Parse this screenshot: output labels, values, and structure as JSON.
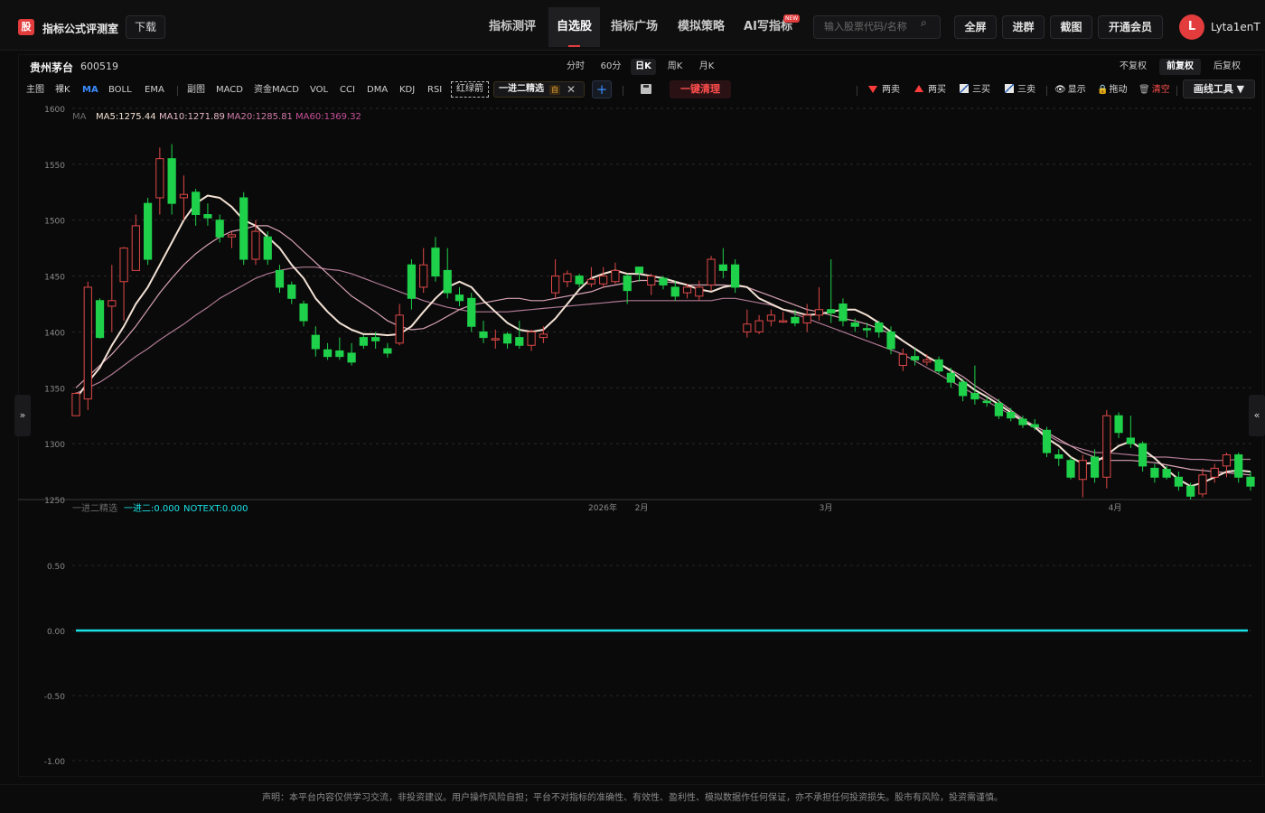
{
  "header": {
    "logo_char": "股",
    "app_title": "指标公式评测室",
    "download": "下载",
    "nav": [
      "指标测评",
      "自选股",
      "指标广场",
      "模拟策略",
      "AI写指标"
    ],
    "nav_active": "自选股",
    "new_badge": "NEW",
    "search_placeholder": "输入股票代码/名称",
    "buttons": [
      "全屏",
      "进群",
      "截图",
      "开通会员"
    ],
    "avatar_letter": "L",
    "username": "Lyta1enT"
  },
  "stock": {
    "name": "贵州茅台",
    "code": "600519"
  },
  "periods": [
    "分时",
    "60分",
    "日K",
    "周K",
    "月K"
  ],
  "period_active": "日K",
  "adjust": [
    "不复权",
    "前复权",
    "后复权"
  ],
  "adjust_active": "前复权",
  "toolbar": {
    "main_indicators": [
      "主图",
      "裸K",
      "MA",
      "BOLL",
      "EMA"
    ],
    "main_active": "MA",
    "sub_indicators": [
      "副图",
      "MACD",
      "资金MACD",
      "VOL",
      "CCI",
      "DMA",
      "KDJ",
      "RSI"
    ],
    "redgreen": "红绿箭",
    "selected_formula": "一进二精选",
    "self_tag": "自",
    "clear_label": "一键清理",
    "signals": [
      "两卖",
      "两买",
      "三买",
      "三卖",
      "显示",
      "拖动",
      "清空"
    ],
    "draw_tools": "画线工具 ▼"
  },
  "ma_legend": {
    "label": "MA",
    "ma5": "MA5:1275.44",
    "ma10": "MA10:1271.89",
    "ma20": "MA20:1285.81",
    "ma60": "MA60:1369.32"
  },
  "sub_legend": {
    "name": "一进二精选",
    "v1": "一进二:0.000",
    "v2": "NOTEXT:0.000"
  },
  "colors": {
    "up": "#e04848",
    "down": "#1fd14a",
    "ma5": "#f3e1d4",
    "ma10": "#d9a3b5",
    "ma20": "#b07a94",
    "ma60": "#9a5a84",
    "sub_line": "#19e3e6",
    "accent": "#e23c3c"
  },
  "chart_data": {
    "type": "candlestick",
    "y_main": {
      "min": 1250,
      "max": 1600,
      "ticks": [
        1600,
        1550,
        1500,
        1450,
        1400,
        1350,
        1300,
        1250
      ]
    },
    "y_sub": {
      "min": -1.0,
      "max": 1.0,
      "ticks": [
        0.5,
        0.0,
        -0.5,
        -1.0
      ]
    },
    "x_labels": [
      "2026年",
      "2月",
      "3月",
      "4月"
    ],
    "candles": [
      [
        1325,
        1345,
        1325,
        1346,
        1325
      ],
      [
        1340,
        1440,
        1335,
        1445,
        1330
      ],
      [
        1428,
        1395,
        1395,
        1430,
        1394
      ],
      [
        1423,
        1428,
        1425,
        1460,
        1400
      ],
      [
        1445,
        1475,
        1440,
        1476,
        1410
      ],
      [
        1455,
        1495,
        1460,
        1505,
        1455
      ],
      [
        1515,
        1465,
        1465,
        1520,
        1460
      ],
      [
        1520,
        1555,
        1515,
        1565,
        1505
      ],
      [
        1555,
        1515,
        1515,
        1568,
        1505
      ],
      [
        1520,
        1523,
        1508,
        1540,
        1500
      ],
      [
        1525,
        1505,
        1505,
        1528,
        1495
      ],
      [
        1505,
        1502,
        1502,
        1515,
        1495
      ],
      [
        1500,
        1485,
        1485,
        1505,
        1480
      ],
      [
        1485,
        1487,
        1485,
        1490,
        1475
      ],
      [
        1520,
        1465,
        1465,
        1525,
        1460
      ],
      [
        1465,
        1490,
        1465,
        1500,
        1460
      ],
      [
        1485,
        1465,
        1465,
        1490,
        1460
      ],
      [
        1455,
        1440,
        1440,
        1460,
        1435
      ],
      [
        1442,
        1430,
        1430,
        1445,
        1425
      ],
      [
        1425,
        1410,
        1410,
        1428,
        1405
      ],
      [
        1397,
        1385,
        1385,
        1405,
        1378
      ],
      [
        1384,
        1378,
        1378,
        1390,
        1375
      ],
      [
        1383,
        1378,
        1380,
        1395,
        1375
      ],
      [
        1381,
        1373,
        1375,
        1390,
        1370
      ],
      [
        1395,
        1388,
        1388,
        1397,
        1385
      ],
      [
        1395,
        1392,
        1392,
        1400,
        1385
      ],
      [
        1385,
        1381,
        1382,
        1390,
        1377
      ],
      [
        1390,
        1415,
        1390,
        1425,
        1388
      ],
      [
        1460,
        1430,
        1430,
        1465,
        1420
      ],
      [
        1440,
        1460,
        1440,
        1475,
        1435
      ],
      [
        1475,
        1450,
        1450,
        1485,
        1445
      ],
      [
        1455,
        1435,
        1435,
        1475,
        1430
      ],
      [
        1433,
        1428,
        1428,
        1440,
        1423
      ],
      [
        1430,
        1405,
        1405,
        1435,
        1400
      ],
      [
        1400,
        1395,
        1395,
        1410,
        1390
      ],
      [
        1394,
        1394,
        1394,
        1402,
        1385
      ],
      [
        1398,
        1390,
        1390,
        1400,
        1385
      ],
      [
        1395,
        1388,
        1388,
        1410,
        1385
      ],
      [
        1388,
        1400,
        1388,
        1402,
        1383
      ],
      [
        1395,
        1398,
        1395,
        1405,
        1390
      ],
      [
        1435,
        1450,
        1432,
        1465,
        1430
      ],
      [
        1445,
        1452,
        1445,
        1455,
        1440
      ],
      [
        1450,
        1443,
        1443,
        1452,
        1440
      ],
      [
        1443,
        1447,
        1443,
        1458,
        1440
      ],
      [
        1443,
        1450,
        1443,
        1458,
        1440
      ],
      [
        1445,
        1455,
        1445,
        1462,
        1443
      ],
      [
        1450,
        1437,
        1437,
        1452,
        1425
      ],
      [
        1458,
        1453,
        1453,
        1458,
        1445
      ],
      [
        1442,
        1450,
        1442,
        1452,
        1433
      ],
      [
        1448,
        1442,
        1442,
        1450,
        1438
      ],
      [
        1440,
        1432,
        1432,
        1446,
        1428
      ],
      [
        1435,
        1440,
        1435,
        1443,
        1430
      ],
      [
        1432,
        1440,
        1432,
        1446,
        1428
      ],
      [
        1442,
        1465,
        1440,
        1468,
        1437
      ],
      [
        1460,
        1455,
        1455,
        1475,
        1448
      ],
      [
        1460,
        1440,
        1440,
        1465,
        1435
      ],
      [
        1400,
        1407,
        1400,
        1420,
        1395
      ],
      [
        1400,
        1410,
        1400,
        1415,
        1398
      ],
      [
        1410,
        1415,
        1410,
        1420,
        1405
      ],
      [
        1410,
        1410,
        1410,
        1418,
        1408
      ],
      [
        1413,
        1408,
        1408,
        1420,
        1405
      ],
      [
        1408,
        1415,
        1408,
        1425,
        1400
      ],
      [
        1415,
        1420,
        1415,
        1440,
        1410
      ],
      [
        1420,
        1417,
        1420,
        1465,
        1408
      ],
      [
        1425,
        1410,
        1410,
        1430,
        1405
      ],
      [
        1408,
        1405,
        1405,
        1412,
        1400
      ],
      [
        1403,
        1402,
        1403,
        1408,
        1395
      ],
      [
        1408,
        1400,
        1400,
        1410,
        1395
      ],
      [
        1400,
        1385,
        1385,
        1405,
        1380
      ],
      [
        1370,
        1380,
        1370,
        1385,
        1365
      ],
      [
        1378,
        1375,
        1375,
        1385,
        1370
      ],
      [
        1373,
        1375,
        1373,
        1380,
        1370
      ],
      [
        1375,
        1365,
        1365,
        1378,
        1362
      ],
      [
        1363,
        1355,
        1355,
        1368,
        1350
      ],
      [
        1355,
        1343,
        1343,
        1358,
        1338
      ],
      [
        1345,
        1340,
        1340,
        1370,
        1335
      ],
      [
        1338,
        1337,
        1337,
        1342,
        1333
      ],
      [
        1336,
        1325,
        1325,
        1340,
        1322
      ],
      [
        1328,
        1323,
        1323,
        1332,
        1320
      ],
      [
        1322,
        1317,
        1317,
        1325,
        1314
      ],
      [
        1317,
        1315,
        1315,
        1322,
        1312
      ],
      [
        1312,
        1292,
        1292,
        1315,
        1288
      ],
      [
        1290,
        1287,
        1287,
        1295,
        1280
      ],
      [
        1285,
        1270,
        1270,
        1288,
        1268
      ],
      [
        1268,
        1285,
        1268,
        1290,
        1252
      ],
      [
        1288,
        1270,
        1270,
        1295,
        1265
      ],
      [
        1270,
        1325,
        1270,
        1330,
        1260
      ],
      [
        1325,
        1310,
        1310,
        1328,
        1305
      ],
      [
        1305,
        1300,
        1300,
        1325,
        1296
      ],
      [
        1300,
        1280,
        1280,
        1302,
        1275
      ],
      [
        1278,
        1270,
        1270,
        1282,
        1265
      ],
      [
        1277,
        1270,
        1270,
        1280,
        1268
      ],
      [
        1270,
        1262,
        1262,
        1275,
        1258
      ],
      [
        1262,
        1253,
        1253,
        1265,
        1250
      ],
      [
        1255,
        1272,
        1255,
        1278,
        1252
      ],
      [
        1270,
        1278,
        1270,
        1282,
        1265
      ],
      [
        1280,
        1290,
        1280,
        1292,
        1270
      ],
      [
        1290,
        1270,
        1270,
        1292,
        1265
      ],
      [
        1270,
        1262,
        1262,
        1275,
        1258
      ]
    ],
    "ma5": [
      1340,
      1355,
      1368,
      1388,
      1405,
      1425,
      1440,
      1460,
      1480,
      1500,
      1515,
      1522,
      1520,
      1512,
      1500,
      1495,
      1485,
      1475,
      1460,
      1448,
      1430,
      1418,
      1408,
      1402,
      1398,
      1398,
      1397,
      1398,
      1405,
      1418,
      1430,
      1440,
      1445,
      1440,
      1428,
      1418,
      1408,
      1402,
      1400,
      1402,
      1412,
      1425,
      1438,
      1448,
      1452,
      1455,
      1452,
      1452,
      1450,
      1448,
      1445,
      1442,
      1438,
      1436,
      1440,
      1442,
      1440,
      1430,
      1425,
      1420,
      1418,
      1415,
      1416,
      1418,
      1420,
      1420,
      1415,
      1408,
      1400,
      1392,
      1385,
      1378,
      1372,
      1365,
      1356,
      1348,
      1342,
      1335,
      1328,
      1320,
      1315,
      1305,
      1298,
      1288,
      1282,
      1283,
      1290,
      1298,
      1302,
      1295,
      1287,
      1277,
      1268,
      1262,
      1265,
      1270,
      1275,
      1276,
      1275
    ],
    "ma10": [
      1350,
      1360,
      1370,
      1380,
      1392,
      1405,
      1420,
      1435,
      1448,
      1460,
      1470,
      1478,
      1485,
      1490,
      1492,
      1495,
      1495,
      1490,
      1482,
      1472,
      1462,
      1452,
      1442,
      1432,
      1425,
      1418,
      1410,
      1405,
      1402,
      1403,
      1408,
      1414,
      1420,
      1424,
      1426,
      1428,
      1430,
      1430,
      1428,
      1428,
      1430,
      1432,
      1434,
      1436,
      1440,
      1442,
      1444,
      1446,
      1446,
      1445,
      1444,
      1442,
      1442,
      1442,
      1442,
      1441,
      1440,
      1436,
      1432,
      1428,
      1424,
      1420,
      1418,
      1415,
      1412,
      1410,
      1407,
      1403,
      1398,
      1392,
      1385,
      1378,
      1372,
      1366,
      1360,
      1352,
      1345,
      1338,
      1330,
      1322,
      1316,
      1310,
      1304,
      1298,
      1292,
      1288,
      1285,
      1285,
      1285,
      1284,
      1283,
      1281,
      1279,
      1277,
      1276,
      1275,
      1274,
      1273,
      1272
    ],
    "ma20": [
      1345,
      1350,
      1355,
      1362,
      1370,
      1378,
      1385,
      1393,
      1400,
      1407,
      1415,
      1422,
      1430,
      1436,
      1442,
      1448,
      1452,
      1455,
      1457,
      1458,
      1458,
      1456,
      1455,
      1452,
      1448,
      1444,
      1440,
      1436,
      1432,
      1428,
      1425,
      1422,
      1420,
      1418,
      1418,
      1418,
      1418,
      1419,
      1420,
      1421,
      1422,
      1423,
      1424,
      1425,
      1426,
      1427,
      1428,
      1428,
      1428,
      1428,
      1428,
      1428,
      1428,
      1428,
      1430,
      1430,
      1428,
      1426,
      1424,
      1420,
      1416,
      1412,
      1408,
      1404,
      1400,
      1396,
      1392,
      1388,
      1384,
      1380,
      1374,
      1368,
      1362,
      1356,
      1350,
      1344,
      1338,
      1332,
      1326,
      1320,
      1314,
      1308,
      1302,
      1298,
      1295,
      1292,
      1292,
      1291,
      1290,
      1289,
      1288,
      1288,
      1287,
      1286,
      1286,
      1285,
      1285,
      1286,
      1286
    ]
  },
  "footer": "声明：本平台内容仅供学习交流，非投资建议。用户操作风险自担；平台不对指标的准确性、有效性、盈利性、模拟数据作任何保证，亦不承担任何投资损失。股市有风险，投资需谨慎。"
}
